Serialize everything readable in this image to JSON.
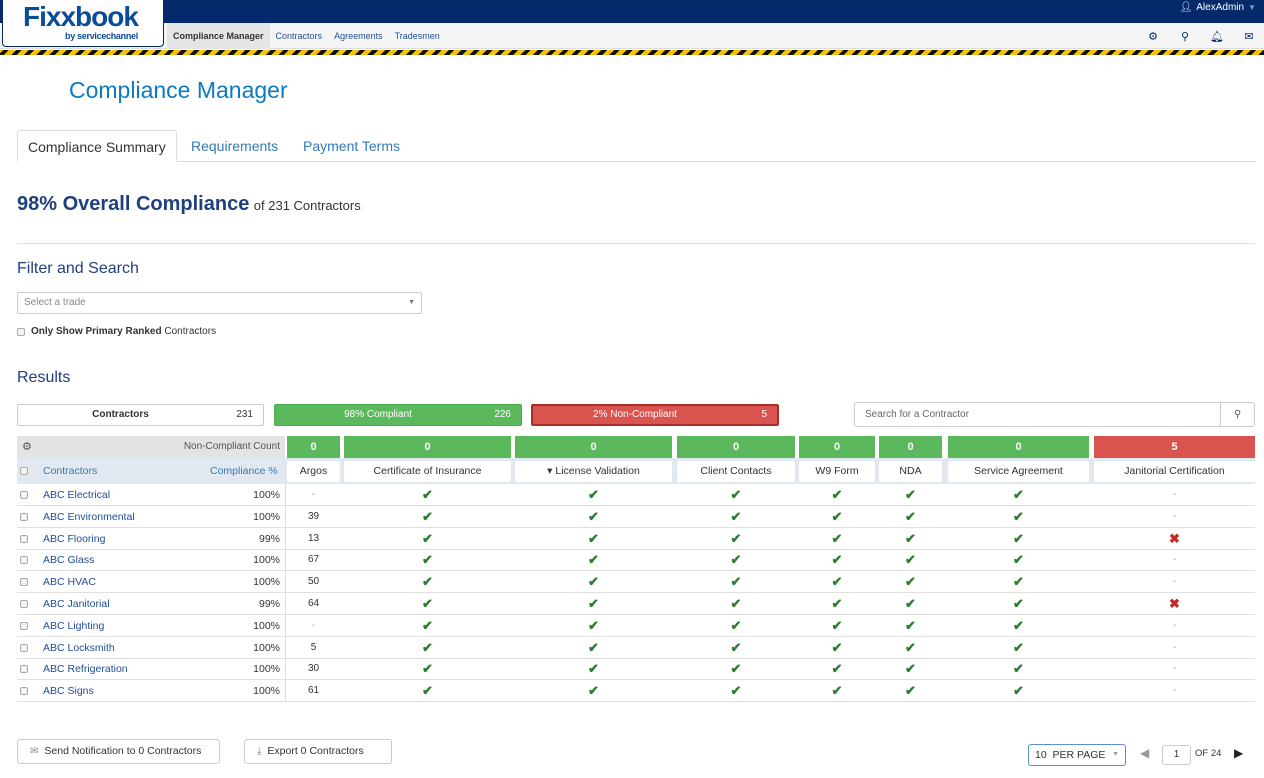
{
  "header": {
    "logo_main": "Fixxbook",
    "logo_sub": "by servicechannel",
    "user_name": "AlexAdmin",
    "nav_items": [
      {
        "label": "Compliance Manager",
        "active": true
      },
      {
        "label": "Contractors",
        "active": false
      },
      {
        "label": "Agreements",
        "active": false
      },
      {
        "label": "Tradesmen",
        "active": false
      }
    ],
    "icons": [
      "gear-icon",
      "search-icon",
      "bell-icon",
      "envelope-icon"
    ]
  },
  "page": {
    "title": "Compliance Manager",
    "tabs": [
      {
        "label": "Compliance Summary",
        "active": true
      },
      {
        "label": "Requirements",
        "active": false
      },
      {
        "label": "Payment Terms",
        "active": false
      }
    ],
    "overall_compliance": "98% Overall Compliance",
    "overall_suffix": "of 231 Contractors"
  },
  "filter": {
    "title": "Filter and Search",
    "trade_placeholder": "Select a trade",
    "primary_bold": "Only Show Primary Ranked",
    "primary_rest": "Contractors"
  },
  "results": {
    "title": "Results",
    "stats": {
      "all_label": "Contractors",
      "all_count": "231",
      "compliant_label": "98% Compliant",
      "compliant_count": "226",
      "noncompliant_label": "2% Non-Compliant",
      "noncompliant_count": "5"
    },
    "search_placeholder": "Search for a Contractor",
    "non_compliant_count_label": "Non-Compliant Count",
    "contractors_header": "Contractors",
    "compliance_header": "Compliance %",
    "requirements": [
      {
        "label": "Argos",
        "count": "0",
        "status": "green"
      },
      {
        "label": "Certificate of Insurance",
        "count": "0",
        "status": "green"
      },
      {
        "label": "License Validation",
        "count": "0",
        "status": "green",
        "sorted": true
      },
      {
        "label": "Client Contacts",
        "count": "0",
        "status": "green"
      },
      {
        "label": "W9 Form",
        "count": "0",
        "status": "green"
      },
      {
        "label": "NDA",
        "count": "0",
        "status": "green"
      },
      {
        "label": "Service Agreement",
        "count": "0",
        "status": "green"
      },
      {
        "label": "Janitorial Certification",
        "count": "5",
        "status": "red"
      }
    ],
    "rows": [
      {
        "name": "ABC Electrical",
        "pct": "100%",
        "cells": [
          "-",
          "ok",
          "ok",
          "ok",
          "ok",
          "ok",
          "ok",
          "-"
        ]
      },
      {
        "name": "ABC Environmental",
        "pct": "100%",
        "cells": [
          "39",
          "ok",
          "ok",
          "ok",
          "ok",
          "ok",
          "ok",
          "-"
        ]
      },
      {
        "name": "ABC Flooring",
        "pct": "99%",
        "cells": [
          "13",
          "ok",
          "ok",
          "ok",
          "ok",
          "ok",
          "ok",
          "x"
        ]
      },
      {
        "name": "ABC Glass",
        "pct": "100%",
        "cells": [
          "67",
          "ok",
          "ok",
          "ok",
          "ok",
          "ok",
          "ok",
          "-"
        ]
      },
      {
        "name": "ABC HVAC",
        "pct": "100%",
        "cells": [
          "50",
          "ok",
          "ok",
          "ok",
          "ok",
          "ok",
          "ok",
          "-"
        ]
      },
      {
        "name": "ABC Janitorial",
        "pct": "99%",
        "cells": [
          "64",
          "ok",
          "ok",
          "ok",
          "ok",
          "ok",
          "ok",
          "x"
        ]
      },
      {
        "name": "ABC Lighting",
        "pct": "100%",
        "cells": [
          "-",
          "ok",
          "ok",
          "ok",
          "ok",
          "ok",
          "ok",
          "-"
        ]
      },
      {
        "name": "ABC Locksmith",
        "pct": "100%",
        "cells": [
          "5",
          "ok",
          "ok",
          "ok",
          "ok",
          "ok",
          "ok",
          "-"
        ]
      },
      {
        "name": "ABC Refrigeration",
        "pct": "100%",
        "cells": [
          "30",
          "ok",
          "ok",
          "ok",
          "ok",
          "ok",
          "ok",
          "-"
        ]
      },
      {
        "name": "ABC Signs",
        "pct": "100%",
        "cells": [
          "61",
          "ok",
          "ok",
          "ok",
          "ok",
          "ok",
          "ok",
          "-"
        ]
      }
    ]
  },
  "footer": {
    "notify_label": "Send Notification to 0 Contractors",
    "export_label": "Export 0 Contractors",
    "per_page": "10  PER PAGE",
    "current_page": "1",
    "page_of": "OF 24"
  }
}
